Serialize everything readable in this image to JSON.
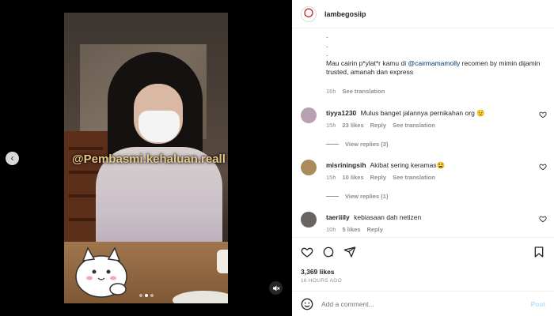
{
  "post": {
    "username": "lambegosiip",
    "caption_dots": [
      ".",
      ".",
      "."
    ],
    "caption_text_before": "Mau cairin p*ylat*r kamu di ",
    "caption_mention": "@cairmamamolly",
    "caption_text_after": " recomen by mimin dijamin trusted, amanah dan express",
    "caption_time": "16h",
    "see_translation": "See translation",
    "likes": "3,369 likes",
    "time_ago": "16 HOURS AGO"
  },
  "media": {
    "watermark": "@Pembasmi.kehaluan.reall",
    "carousel_dots": 3,
    "active_dot": 1
  },
  "comments": [
    {
      "username": "tiyya1230",
      "text": "Mulus banget jalannya pernikahan org 😟",
      "time": "15h",
      "likes": "23 likes",
      "reply": "Reply",
      "translate": "See translation",
      "view_replies": "View replies (3)",
      "avatar_color": "#b9a0b4"
    },
    {
      "username": "misriningsih",
      "text": "Akibat sering keramas😫",
      "time": "15h",
      "likes": "10 likes",
      "reply": "Reply",
      "translate": "See translation",
      "view_replies": "View replies (1)",
      "avatar_color": "#a98c5a"
    },
    {
      "username": "taeriiily",
      "text": "kebiasaan dah netizen",
      "time": "10h",
      "likes": "5 likes",
      "reply": "Reply",
      "avatar_color": "#6a6460"
    }
  ],
  "add_comment": {
    "placeholder": "Add a comment...",
    "post_label": "Post"
  },
  "icons": {
    "like": "heart-icon",
    "comment": "comment-icon",
    "share": "share-icon",
    "save": "bookmark-icon",
    "emoji": "emoji-icon",
    "prev": "chevron-left-icon",
    "mute": "muted-speaker-icon"
  }
}
